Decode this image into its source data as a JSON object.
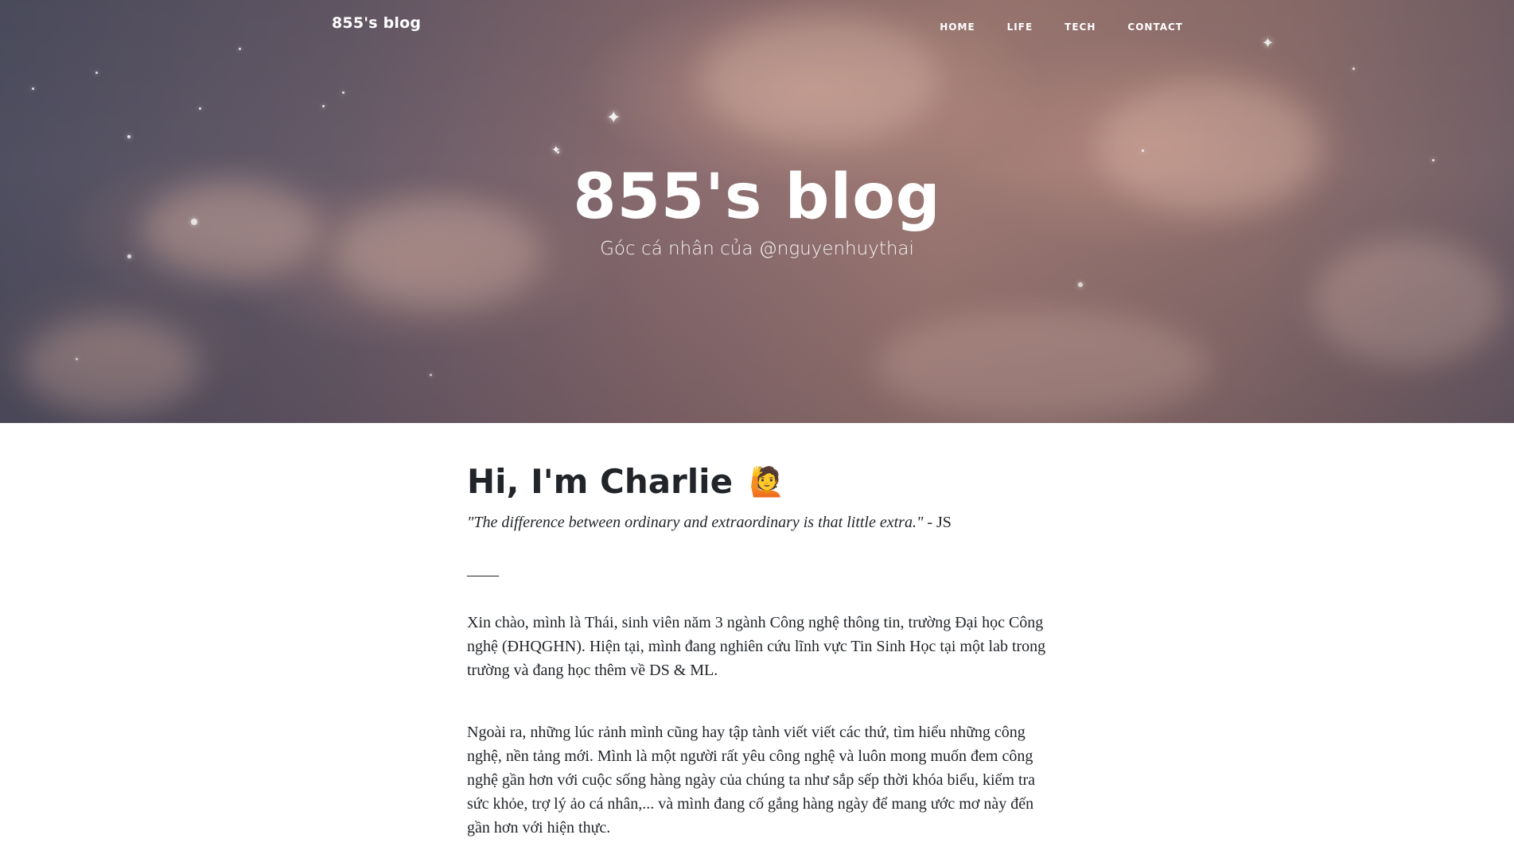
{
  "navbar": {
    "brand": "855's blog",
    "links": [
      "HOME",
      "LIFE",
      "TECH",
      "CONTACT"
    ]
  },
  "hero": {
    "title": "855's blog",
    "subtitle": "Góc cá nhân của @nguyenhuythai"
  },
  "post": {
    "heading": "Hi, I'm Charlie",
    "heading_emoji": "🙋",
    "quote_italic": "\"The difference between ordinary and extraordinary is that little extra.\"",
    "quote_author": " - JS",
    "divider": "——",
    "paragraphs": [
      "Xin chào, mình là Thái, sinh viên năm 3 ngành Công nghệ thông tin, trường Đại học Công nghệ (ĐHQGHN). Hiện tại, mình đang nghiên cứu lĩnh vực Tin Sinh Học tại một lab trong trường và đang học thêm về DS & ML.",
      "Ngoài ra, những lúc rảnh mình cũng hay tập tành viết viết các thứ, tìm hiểu những công nghệ, nền tảng mới. Mình là một người rất yêu công nghệ và luôn mong muốn đem công nghệ gần hơn với cuộc sống hàng ngày của chúng ta như sắp sếp thời khóa biểu, kiểm tra sức khỏe, trợ lý ảo cá nhân,... và mình đang cố gắng hàng ngày để mang ước mơ này đến gần hơn với hiện thực."
    ]
  },
  "colors": {
    "text": "#212529",
    "hero_text": "#ffffff"
  }
}
